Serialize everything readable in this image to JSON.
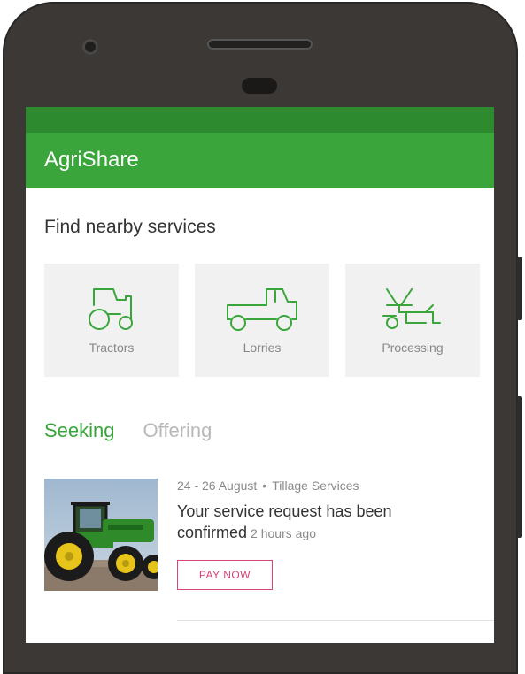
{
  "app": {
    "title": "AgriShare"
  },
  "services": {
    "heading": "Find nearby services",
    "items": [
      {
        "label": "Tractors",
        "icon": "tractor-icon"
      },
      {
        "label": "Lorries",
        "icon": "lorry-icon"
      },
      {
        "label": "Processing",
        "icon": "processing-icon"
      }
    ]
  },
  "tabs": [
    {
      "label": "Seeking",
      "active": true
    },
    {
      "label": "Offering",
      "active": false
    }
  ],
  "request": {
    "dates": "24 - 26 August",
    "category": "Tillage Services",
    "message": "Your service request has been confirmed",
    "time_ago": "2 hours ago",
    "action_label": "PAY NOW",
    "image": "green-tractor-photo"
  },
  "colors": {
    "accent": "#3aa53b",
    "status_bar": "#2d8a2e",
    "pay_button": "#d9427a"
  }
}
